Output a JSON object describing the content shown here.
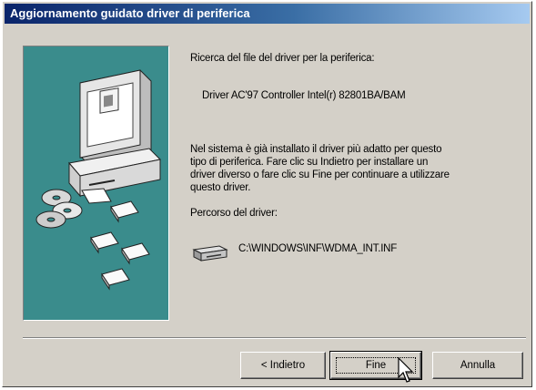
{
  "window": {
    "title": "Aggiornamento guidato driver di periferica"
  },
  "content": {
    "heading": "Ricerca del file del driver per la periferica:",
    "device_name": "Driver AC'97 Controller Intel(r) 82801BA/BAM",
    "message": "Nel sistema è già installato il driver più adatto per questo\ntipo di periferica. Fare clic su Indietro per installare un\ndriver diverso o fare clic su Fine per continuare a utilizzare\nquesto driver.",
    "path_label": "Percorso del driver:",
    "path_value": "C:\\WINDOWS\\INF\\WDMA_INT.INF"
  },
  "buttons": {
    "back_label": "< Indietro",
    "finish_label": "Fine",
    "cancel_label": "Annulla"
  },
  "colors": {
    "title_bar_start": "#0a246a",
    "title_bar_end": "#a6caf0",
    "dialog_face": "#d4d0c8",
    "illustration_background": "#3a8c8c"
  },
  "icons": {
    "illustration": "computer-with-cds-and-floppies",
    "path": "disk-drive-icon",
    "cursor": "mouse-pointer"
  }
}
